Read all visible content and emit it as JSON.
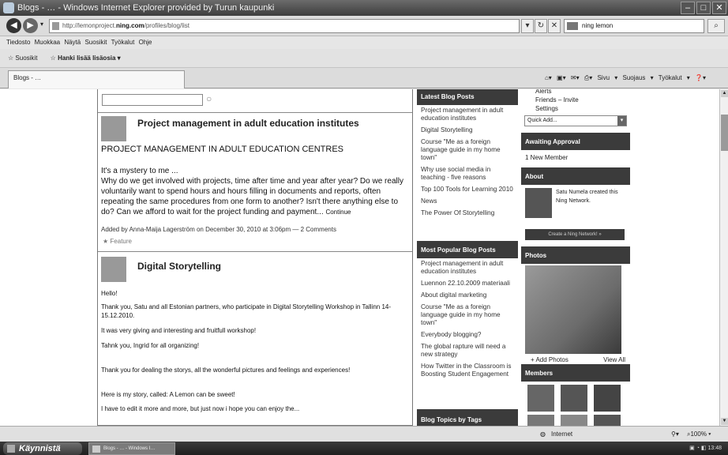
{
  "window": {
    "title": "Blogs - … - Windows Internet Explorer provided by Turun kaupunki"
  },
  "address": {
    "url_prefix": "http://lemonproject.",
    "url_host": "ning.com",
    "url_path": "/profiles/blog/list",
    "search_text": "ning lemon"
  },
  "menus": [
    "Tiedosto",
    "Muokkaa",
    "Näytä",
    "Suosikit",
    "Työkalut",
    "Ohje"
  ],
  "favorites": {
    "label": "Suosikit",
    "hint": "Hanki lisää lisäosia ▾"
  },
  "tab": {
    "label": "Blogs - …"
  },
  "toolbar_cmds": [
    "Sivu ▾",
    "Suojaus ▾",
    "Työkalut ▾"
  ],
  "main": {
    "search_placeholder": "",
    "post1": {
      "title": "Project management in adult education institutes",
      "heading": "PROJECT MANAGEMENT IN ADULT EDUCATION CENTRES",
      "line1": "It's a mystery to me ...",
      "body": "Why do we get involved with projects, time after time and year after year? Do we really voluntarily want to spend hours and hours filling in documents and reports, often repeating the same procedures from one form to another? Isn't there anything else to do? Can we afford to wait for the project funding and payment...",
      "continue": "Continue",
      "meta": "Added by Anna-Maija Lagerström on December 30, 2010 at 3:06pm — 2 Comments",
      "feature": "Feature"
    },
    "post2": {
      "title": "Digital Storytelling",
      "p1": "Hello!",
      "p2": "Thank you, Satu and all Estonian partners, who participate in Digital Storytelling Workshop in Tallinn 14-15.12.2010.",
      "p3": "It was very giving and interesting and fruitfull workshop!",
      "p4": "Tahnk you, Ingrid for all organizing!",
      "p5": "Thank you for dealing the storys, all the wonderful pictures and feelings and experiences!",
      "p6": "Here is my story, called: A Lemon can be sweet!",
      "p7": "I have to edit it more and more, but just now i hope you can enjoy the..."
    }
  },
  "latest": {
    "header": "Latest Blog Posts",
    "items": [
      "Project management in adult education institutes",
      "Digital Storytelling",
      "Course \"Me as a foreign language guide in my home town\"",
      "Why use social media in teaching - five reasons",
      "Top 100 Tools for Learning 2010",
      "News",
      "The Power Of Storytelling"
    ]
  },
  "popular": {
    "header": "Most Popular Blog Posts",
    "items": [
      "Project management in adult education institutes",
      "Luennon 22.10.2009 materiaali",
      "About digital marketing",
      "Course \"Me as a foreign language guide in my home town\"",
      "Everybody blogging?",
      "The global rapture will need a new strategy",
      "How Twitter in the Classroom is Boosting Student Engagement"
    ]
  },
  "tags": {
    "header": "Blog Topics by Tags"
  },
  "right": {
    "links": [
      "Alerts",
      "Friends – Invite",
      "Settings"
    ],
    "quickadd": "Quick Add...",
    "approval_header": "Awaiting Approval",
    "approval_item": "1 New Member",
    "about_header": "About",
    "about_text": "Satu Numela created this Ning Network.",
    "create_btn": "Create a Ning Network! »",
    "photos_header": "Photos",
    "add_photos": "+ Add Photos",
    "view_all": "View All",
    "members_header": "Members"
  },
  "status": {
    "zone": "Internet",
    "zoom": "100%"
  },
  "taskbar": {
    "start": "Käynnistä",
    "task": "Blogs - … - Windows I…",
    "clock": "13:48"
  }
}
